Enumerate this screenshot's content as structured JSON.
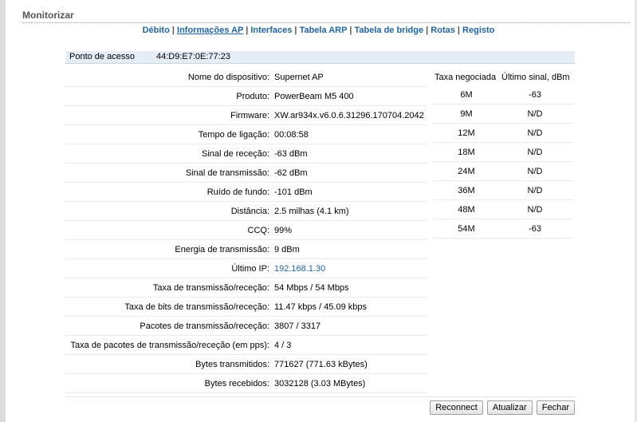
{
  "page": {
    "title": "Monitorizar"
  },
  "tabs": [
    {
      "label": "Débito",
      "active": false
    },
    {
      "label": "Informações AP",
      "active": true
    },
    {
      "label": "Interfaces",
      "active": false
    },
    {
      "label": "Tabela ARP",
      "active": false
    },
    {
      "label": "Tabela de bridge",
      "active": false
    },
    {
      "label": "Rotas",
      "active": false
    },
    {
      "label": "Registo",
      "active": false
    }
  ],
  "access_point": {
    "label": "Ponto de acesso",
    "mac": "44:D9:E7:0E:77:23"
  },
  "info": [
    {
      "label": "Nome do dispositivo:",
      "value": "Supernet AP"
    },
    {
      "label": "Produto:",
      "value": "PowerBeam M5 400"
    },
    {
      "label": "Firmware:",
      "value": "XW.ar934x.v6.0.6.31296.170704.2042"
    },
    {
      "label": "Tempo de ligação:",
      "value": "00:08:58"
    },
    {
      "label": "Sinal de receção:",
      "value": "-63 dBm"
    },
    {
      "label": "Sinal de transmissão:",
      "value": "-62 dBm"
    },
    {
      "label": "Ruído de fundo:",
      "value": "-101 dBm"
    },
    {
      "label": "Distância:",
      "value": "2.5 milhas (4.1 km)"
    },
    {
      "label": "CCQ:",
      "value": "99%"
    },
    {
      "label": "Energia de transmissão:",
      "value": "9 dBm"
    },
    {
      "label": "Último IP:",
      "value": "192.168.1.30"
    },
    {
      "label": "Taxa de transmissão/receção:",
      "value": "54 Mbps / 54 Mbps"
    },
    {
      "label": "Taxa de bits de transmissão/receção:",
      "value": "11.47 kbps / 45.09 kbps"
    },
    {
      "label": "Pacotes de transmissão/receção:",
      "value": "3807 / 3317"
    },
    {
      "label": "Taxa de pacotes de transmissão/receção (em pps):",
      "value": "4 / 3"
    },
    {
      "label": "Bytes transmitidos:",
      "value": "771627 (771.63 kBytes)"
    },
    {
      "label": "Bytes recebidos:",
      "value": "3032128 (3.03 MBytes)"
    }
  ],
  "rates": {
    "headers": [
      "Taxa negociada",
      "Último sinal, dBm"
    ],
    "rows": [
      [
        "6M",
        "-63"
      ],
      [
        "9M",
        "N/D"
      ],
      [
        "12M",
        "N/D"
      ],
      [
        "18M",
        "N/D"
      ],
      [
        "24M",
        "N/D"
      ],
      [
        "36M",
        "N/D"
      ],
      [
        "48M",
        "N/D"
      ],
      [
        "54M",
        "-63"
      ]
    ]
  },
  "buttons": {
    "reconnect": "Reconnect",
    "refresh": "Atualizar",
    "close": "Fechar"
  },
  "colors": {
    "link": "#1f64a5",
    "header_bg": "#e5eef5"
  }
}
